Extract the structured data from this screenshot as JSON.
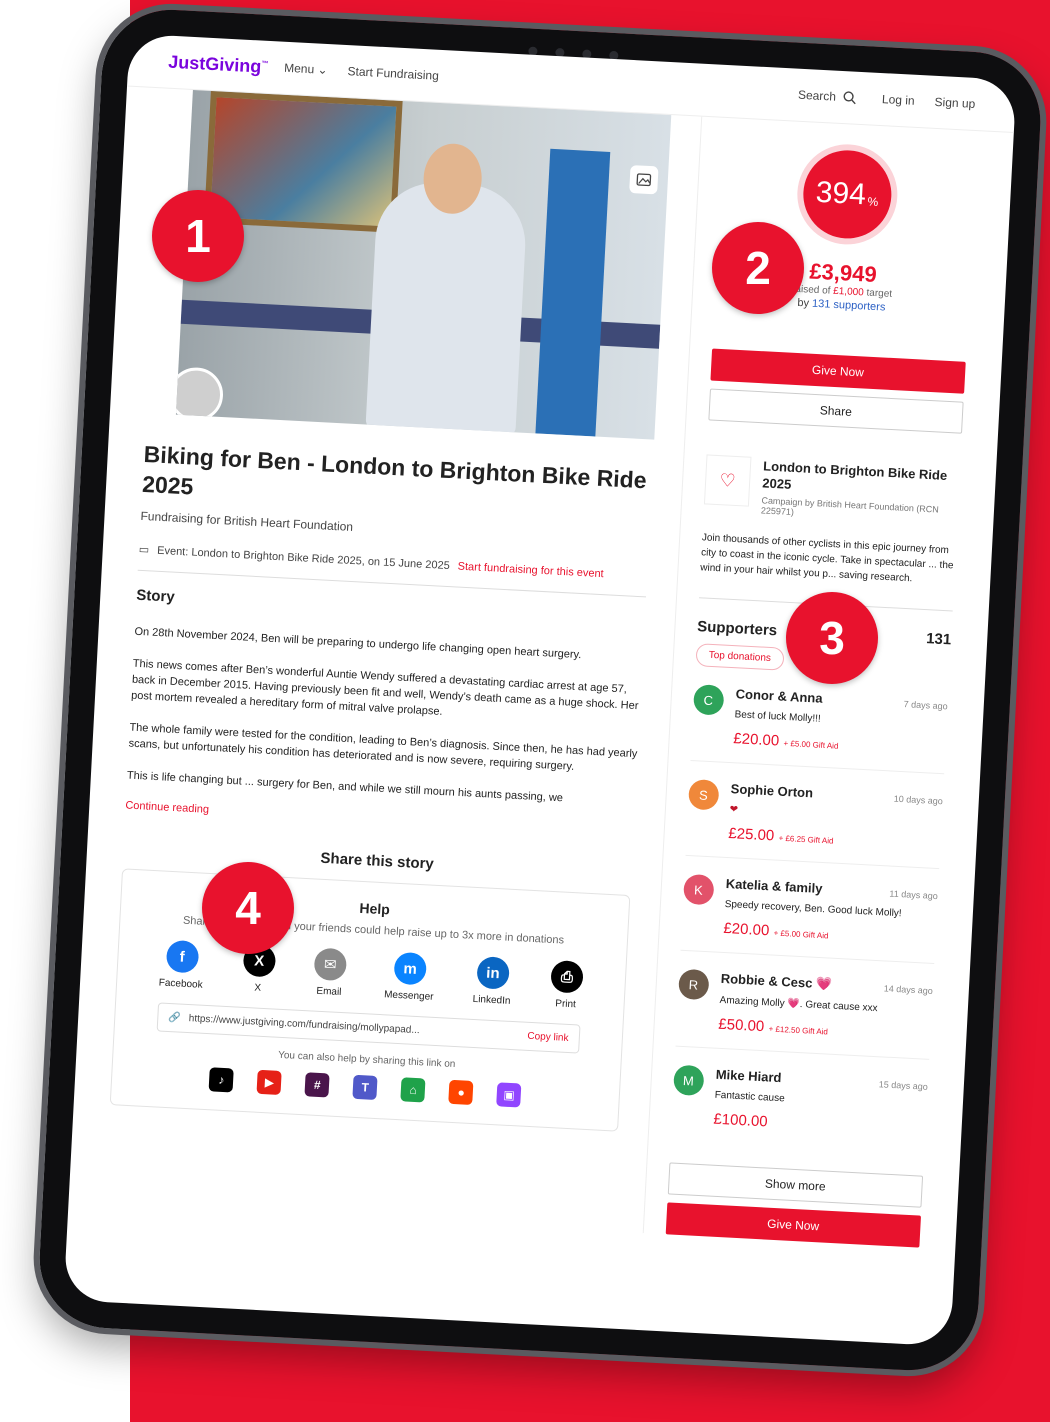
{
  "nav": {
    "logo": "JustGiving",
    "logo_tm": "™",
    "menu": "Menu",
    "start": "Start Fundraising",
    "search": "Search",
    "login": "Log in",
    "signup": "Sign up"
  },
  "page": {
    "title": "Biking for Ben - London to Brighton Bike Ride 2025",
    "subtitle": "Fundraising for British Heart Foundation",
    "event_text": "Event: London to Brighton Bike Ride 2025, on 15 June 2025",
    "event_link": "Start fundraising for this event"
  },
  "story": {
    "heading": "Story",
    "p1": "On 28th November 2024, Ben will be preparing to undergo life changing open heart surgery.",
    "p2": "This news comes after Ben’s wonderful Auntie Wendy suffered a devastating cardiac arrest at age 57, back in December 2015. Having previously been fit and well, Wendy’s death came as a huge shock. Her post mortem revealed a hereditary form of mitral valve prolapse.",
    "p3": "The whole family were tested for the condition, leading to Ben’s diagnosis. Since then, he has had yearly scans, but unfortunately his condition has deteriorated and is now severe, requiring surgery.",
    "p4": "This is life changing but ... surgery for Ben, and while we still mourn his aunts passing, we",
    "continue": "Continue reading"
  },
  "share": {
    "title": "Share this story",
    "help_heading": "Help",
    "help_sub": "Sharing this page with your friends could help raise up to 3x more in donations",
    "items": [
      {
        "label": "Facebook",
        "glyph": "f",
        "color": "#1877f2"
      },
      {
        "label": "X",
        "glyph": "X",
        "color": "#000000"
      },
      {
        "label": "Email",
        "glyph": "✉",
        "color": "#8a8a8a"
      },
      {
        "label": "Messenger",
        "glyph": "m",
        "color": "#0a84ff"
      },
      {
        "label": "LinkedIn",
        "glyph": "in",
        "color": "#0a66c2"
      },
      {
        "label": "Print",
        "glyph": "⎙",
        "color": "#000000"
      }
    ],
    "url": "https://www.justgiving.com/fundraising/mollypapad...",
    "copy": "Copy link",
    "also": "You can also help by sharing this link on",
    "social_colors": [
      "#000000",
      "#e62117",
      "#4a154b",
      "#5059c9",
      "#1fa24a",
      "#ff4500",
      "#9146ff"
    ]
  },
  "progress": {
    "percent": "394",
    "percent_sign": "%",
    "raised": "£3,949",
    "raised_of": "raised of",
    "target_amount": "£1,000",
    "target": "target",
    "by": "by",
    "supporters": "131 supporters",
    "give": "Give Now",
    "share": "Share"
  },
  "charity": {
    "name": "London to Brighton Bike Ride 2025",
    "campaign": "Campaign by British Heart Foundation (RCN 225971)",
    "desc": "Join thousands of other cyclists in this epic journey from city to coast in the iconic cycle. Take in spectacular ... the wind in your hair whilst you p... saving research."
  },
  "supporters": {
    "heading": "Supporters",
    "count": "131",
    "filter": "Top donations",
    "list": [
      {
        "initial": "C",
        "name": "Conor & Anna",
        "time": "7 days ago",
        "msg": "Best of luck Molly!!!",
        "amount": "£20.00",
        "gift": "+ £5.00 Gift Aid",
        "color": "#2ea35a"
      },
      {
        "initial": "S",
        "name": "Sophie Orton",
        "time": "10 days ago",
        "msg": "❤",
        "amount": "£25.00",
        "gift": "+ £6.25 Gift Aid",
        "color": "#f0883a"
      },
      {
        "initial": "K",
        "name": "Katelia & family",
        "time": "11 days ago",
        "msg": "Speedy recovery, Ben. Good luck Molly!",
        "amount": "£20.00",
        "gift": "+ £5.00 Gift Aid",
        "color": "#e2526a"
      },
      {
        "initial": "R",
        "name": "Robbie & Cesc 💗",
        "time": "14 days ago",
        "msg": "Amazing Molly 💗. Great cause xxx",
        "amount": "£50.00",
        "gift": "+ £12.50 Gift Aid",
        "color": "#6b5a4a"
      },
      {
        "initial": "M",
        "name": "Mike Hiard",
        "time": "15 days ago",
        "msg": "Fantastic cause",
        "amount": "£100.00",
        "gift": "",
        "color": "#2ea35a"
      }
    ],
    "show_more": "Show more",
    "give": "Give Now"
  },
  "badges": {
    "one": "1",
    "two": "2",
    "three": "3",
    "four": "4"
  },
  "colors": {
    "brand_red": "#e8122d",
    "logo_purple": "#7a04dd"
  }
}
